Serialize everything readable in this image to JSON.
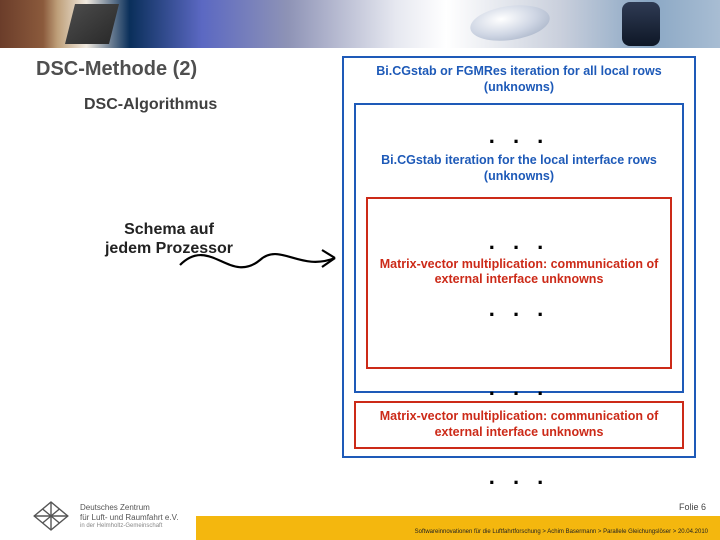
{
  "title": "DSC-Methode (2)",
  "subtitle": "DSC-Algorithmus",
  "schema_label_line1": "Schema auf",
  "schema_label_line2": "jedem Prozessor",
  "dots": ". . .",
  "boxA": {
    "heading": "Bi.CGstab or FGMRes iteration for all local rows (unknowns)"
  },
  "boxB": {
    "heading": "Bi.CGstab iteration for the local interface rows (unknowns)"
  },
  "boxC": {
    "heading": "Matrix-vector multiplication: communication of external interface unknowns"
  },
  "boxD": {
    "heading": "Matrix-vector multiplication: communication of external interface unknowns"
  },
  "footer": {
    "folie": "Folie 6",
    "line": "Softwareinnovationen für die Luftfahrtforschung > Achim Basermann > Parallele Gleichungslöser > 20.04.2010",
    "dlr_name": "Deutsches Zentrum",
    "dlr_name2": "für Luft- und Raumfahrt e.V.",
    "dlr_sub": "in der Helmholtz-Gemeinschaft"
  }
}
